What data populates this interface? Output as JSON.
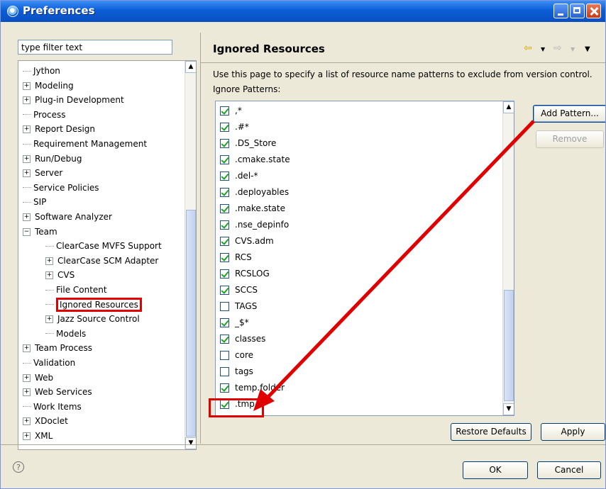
{
  "window": {
    "title": "Preferences"
  },
  "filter": {
    "placeholder": "type filter text",
    "value": "type filter text"
  },
  "tree": {
    "items": [
      {
        "label": "Jython",
        "level": 0,
        "expandable": false
      },
      {
        "label": "Modeling",
        "level": 0,
        "expandable": true
      },
      {
        "label": "Plug-in Development",
        "level": 0,
        "expandable": true
      },
      {
        "label": "Process",
        "level": 0,
        "expandable": false
      },
      {
        "label": "Report Design",
        "level": 0,
        "expandable": true
      },
      {
        "label": "Requirement Management",
        "level": 0,
        "expandable": false
      },
      {
        "label": "Run/Debug",
        "level": 0,
        "expandable": true
      },
      {
        "label": "Server",
        "level": 0,
        "expandable": true
      },
      {
        "label": "Service Policies",
        "level": 0,
        "expandable": false
      },
      {
        "label": "SIP",
        "level": 0,
        "expandable": false
      },
      {
        "label": "Software Analyzer",
        "level": 0,
        "expandable": true
      },
      {
        "label": "Team",
        "level": 0,
        "expandable": true,
        "expanded": true
      },
      {
        "label": "ClearCase MVFS Support",
        "level": 1,
        "expandable": false
      },
      {
        "label": "ClearCase SCM Adapter",
        "level": 1,
        "expandable": true
      },
      {
        "label": "CVS",
        "level": 1,
        "expandable": true
      },
      {
        "label": "File Content",
        "level": 1,
        "expandable": false
      },
      {
        "label": "Ignored Resources",
        "level": 1,
        "expandable": false,
        "selected": true
      },
      {
        "label": "Jazz Source Control",
        "level": 1,
        "expandable": true
      },
      {
        "label": "Models",
        "level": 1,
        "expandable": false
      },
      {
        "label": "Team Process",
        "level": 0,
        "expandable": true
      },
      {
        "label": "Validation",
        "level": 0,
        "expandable": false
      },
      {
        "label": "Web",
        "level": 0,
        "expandable": true
      },
      {
        "label": "Web Services",
        "level": 0,
        "expandable": true
      },
      {
        "label": "Work Items",
        "level": 0,
        "expandable": false
      },
      {
        "label": "XDoclet",
        "level": 0,
        "expandable": true
      },
      {
        "label": "XML",
        "level": 0,
        "expandable": true
      }
    ]
  },
  "page": {
    "title": "Ignored Resources",
    "description": "Use this page to specify a list of resource name patterns to exclude from version control.",
    "patterns_label": "Ignore Patterns:"
  },
  "patterns": [
    {
      "label": ",*",
      "checked": true
    },
    {
      "label": ".#*",
      "checked": true
    },
    {
      "label": ".DS_Store",
      "checked": true
    },
    {
      "label": ".cmake.state",
      "checked": true
    },
    {
      "label": ".del-*",
      "checked": true
    },
    {
      "label": ".deployables",
      "checked": true
    },
    {
      "label": ".make.state",
      "checked": true
    },
    {
      "label": ".nse_depinfo",
      "checked": true
    },
    {
      "label": "CVS.adm",
      "checked": true
    },
    {
      "label": "RCS",
      "checked": true
    },
    {
      "label": "RCSLOG",
      "checked": true
    },
    {
      "label": "SCCS",
      "checked": true
    },
    {
      "label": "TAGS",
      "checked": false
    },
    {
      "label": "_$*",
      "checked": true
    },
    {
      "label": "classes",
      "checked": true
    },
    {
      "label": "core",
      "checked": false
    },
    {
      "label": "tags",
      "checked": false
    },
    {
      "label": "temp.folder",
      "checked": true
    },
    {
      "label": ".tmp",
      "checked": true
    }
  ],
  "buttons": {
    "add_pattern": "Add Pattern...",
    "remove": "Remove",
    "restore_defaults": "Restore Defaults",
    "apply": "Apply",
    "ok": "OK",
    "cancel": "Cancel"
  },
  "icons": {
    "help": "?",
    "back": "⇦",
    "forward": "⇨",
    "dropdown": "▼",
    "view_menu": "▼",
    "scroll_up": "▲",
    "scroll_down": "▼"
  },
  "colors": {
    "highlight": "#e00000",
    "titlebar": "#0b5ed7",
    "check": "#21a121"
  }
}
